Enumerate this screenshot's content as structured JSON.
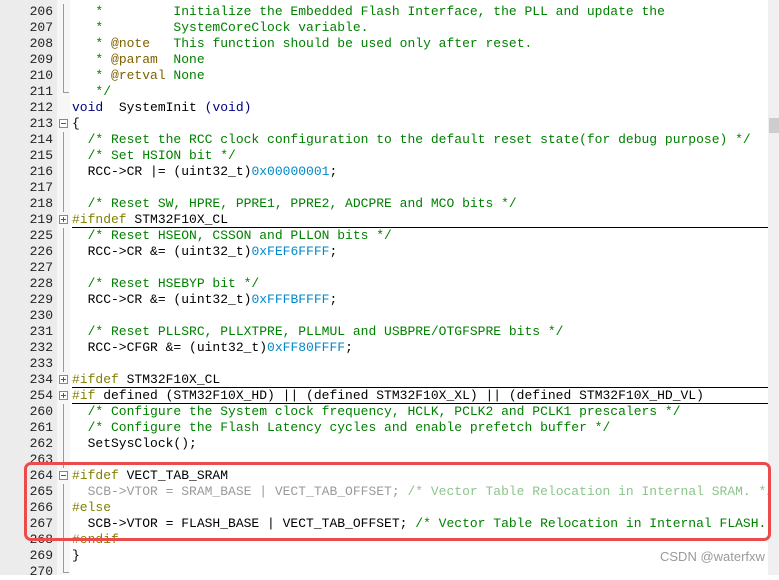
{
  "editor": {
    "lines": [
      {
        "num": "206",
        "fold": "line",
        "tokens": [
          [
            "c",
            "   *         Initialize the Embedded Flash Interface, the PLL and update the"
          ]
        ]
      },
      {
        "num": "207",
        "fold": "line",
        "tokens": [
          [
            "c",
            "   *         SystemCoreClock variable."
          ]
        ]
      },
      {
        "num": "208",
        "fold": "line",
        "tokens": [
          [
            "c",
            "   * "
          ],
          [
            "t",
            "@note"
          ],
          [
            "c",
            "   This function should be used only after reset."
          ]
        ]
      },
      {
        "num": "209",
        "fold": "line",
        "tokens": [
          [
            "c",
            "   * "
          ],
          [
            "t",
            "@param"
          ],
          [
            "c",
            "  None"
          ]
        ]
      },
      {
        "num": "210",
        "fold": "line",
        "tokens": [
          [
            "c",
            "   * "
          ],
          [
            "t",
            "@retval"
          ],
          [
            "c",
            " None"
          ]
        ]
      },
      {
        "num": "211",
        "fold": "end",
        "tokens": [
          [
            "c",
            "   */"
          ]
        ]
      },
      {
        "num": "212",
        "fold": "",
        "tokens": [
          [
            "k",
            "void"
          ],
          [
            "",
            "  SystemInit "
          ],
          [
            "k",
            "(void)"
          ]
        ]
      },
      {
        "num": "213",
        "fold": "minus",
        "tokens": [
          [
            "",
            "{"
          ]
        ]
      },
      {
        "num": "214",
        "fold": "line",
        "tokens": [
          [
            "c",
            "  /* Reset the RCC clock configuration to the default reset state(for debug purpose) */"
          ]
        ]
      },
      {
        "num": "215",
        "fold": "line",
        "tokens": [
          [
            "c",
            "  /* Set HSION bit */"
          ]
        ]
      },
      {
        "num": "216",
        "fold": "line",
        "tokens": [
          [
            "",
            "  RCC->CR |= (uint32_t)"
          ],
          [
            "n",
            "0x00000001"
          ],
          [
            "",
            ";"
          ]
        ]
      },
      {
        "num": "217",
        "fold": "line",
        "tokens": []
      },
      {
        "num": "218",
        "fold": "line",
        "tokens": [
          [
            "c",
            "  /* Reset SW, HPRE, PPRE1, PPRE2, ADCPRE and MCO bits */"
          ]
        ]
      },
      {
        "num": "219",
        "fold": "plus",
        "under": true,
        "tokens": [
          [
            "p",
            "#ifndef"
          ],
          [
            "",
            " STM32F10X_CL"
          ]
        ]
      },
      {
        "num": "225",
        "fold": "line",
        "tokens": [
          [
            "c",
            "  /* Reset HSEON, CSSON and PLLON bits */"
          ]
        ]
      },
      {
        "num": "226",
        "fold": "line",
        "tokens": [
          [
            "",
            "  RCC->CR &= (uint32_t)"
          ],
          [
            "n",
            "0xFEF6FFFF"
          ],
          [
            "",
            ";"
          ]
        ]
      },
      {
        "num": "227",
        "fold": "line",
        "tokens": []
      },
      {
        "num": "228",
        "fold": "line",
        "tokens": [
          [
            "c",
            "  /* Reset HSEBYP bit */"
          ]
        ]
      },
      {
        "num": "229",
        "fold": "line",
        "tokens": [
          [
            "",
            "  RCC->CR &= (uint32_t)"
          ],
          [
            "n",
            "0xFFFBFFFF"
          ],
          [
            "",
            ";"
          ]
        ]
      },
      {
        "num": "230",
        "fold": "line",
        "tokens": []
      },
      {
        "num": "231",
        "fold": "line",
        "tokens": [
          [
            "c",
            "  /* Reset PLLSRC, PLLXTPRE, PLLMUL and USBPRE/OTGFSPRE bits */"
          ]
        ]
      },
      {
        "num": "232",
        "fold": "line",
        "tokens": [
          [
            "",
            "  RCC->CFGR &= (uint32_t)"
          ],
          [
            "n",
            "0xFF80FFFF"
          ],
          [
            "",
            ";"
          ]
        ]
      },
      {
        "num": "233",
        "fold": "line",
        "tokens": []
      },
      {
        "num": "234",
        "fold": "plus",
        "under": true,
        "tokens": [
          [
            "p",
            "#ifdef"
          ],
          [
            "",
            " STM32F10X_CL"
          ]
        ]
      },
      {
        "num": "254",
        "fold": "plus",
        "under": true,
        "tokens": [
          [
            "p",
            "#if"
          ],
          [
            "",
            " defined (STM32F10X_HD) || (defined STM32F10X_XL) || (defined STM32F10X_HD_VL)"
          ]
        ]
      },
      {
        "num": "260",
        "fold": "line",
        "tokens": [
          [
            "c",
            "  /* Configure the System clock frequency, HCLK, PCLK2 and PCLK1 prescalers */"
          ]
        ]
      },
      {
        "num": "261",
        "fold": "line",
        "tokens": [
          [
            "c",
            "  /* Configure the Flash Latency cycles and enable prefetch buffer */"
          ]
        ]
      },
      {
        "num": "262",
        "fold": "line",
        "tokens": [
          [
            "",
            "  SetSysClock();"
          ]
        ]
      },
      {
        "num": "263",
        "fold": "line",
        "tokens": []
      },
      {
        "num": "264",
        "fold": "minus",
        "tokens": [
          [
            "p",
            "#ifdef"
          ],
          [
            "",
            " VECT_TAB_SRAM"
          ]
        ]
      },
      {
        "num": "265",
        "fold": "line",
        "tokens": [
          [
            "ic",
            "  SCB->VTOR = SRAM_BASE | VECT_TAB_OFFSET; "
          ],
          [
            "icc",
            "/* Vector Table Relocation in Internal SRAM. */"
          ]
        ]
      },
      {
        "num": "266",
        "fold": "line",
        "tokens": [
          [
            "p",
            "#else"
          ]
        ]
      },
      {
        "num": "267",
        "fold": "line",
        "tokens": [
          [
            "",
            "  SCB->VTOR = FLASH_BASE | VECT_TAB_OFFSET; "
          ],
          [
            "c",
            "/* Vector Table Relocation in Internal FLASH. */"
          ]
        ]
      },
      {
        "num": "268",
        "fold": "line",
        "tokens": [
          [
            "p",
            "#endif"
          ]
        ]
      },
      {
        "num": "269",
        "fold": "line",
        "tokens": [
          [
            "",
            "}"
          ]
        ]
      },
      {
        "num": "270",
        "fold": "end",
        "tokens": []
      }
    ]
  },
  "highlight": {
    "color": "#ec4b4b"
  },
  "watermark": "CSDN @waterfxw"
}
